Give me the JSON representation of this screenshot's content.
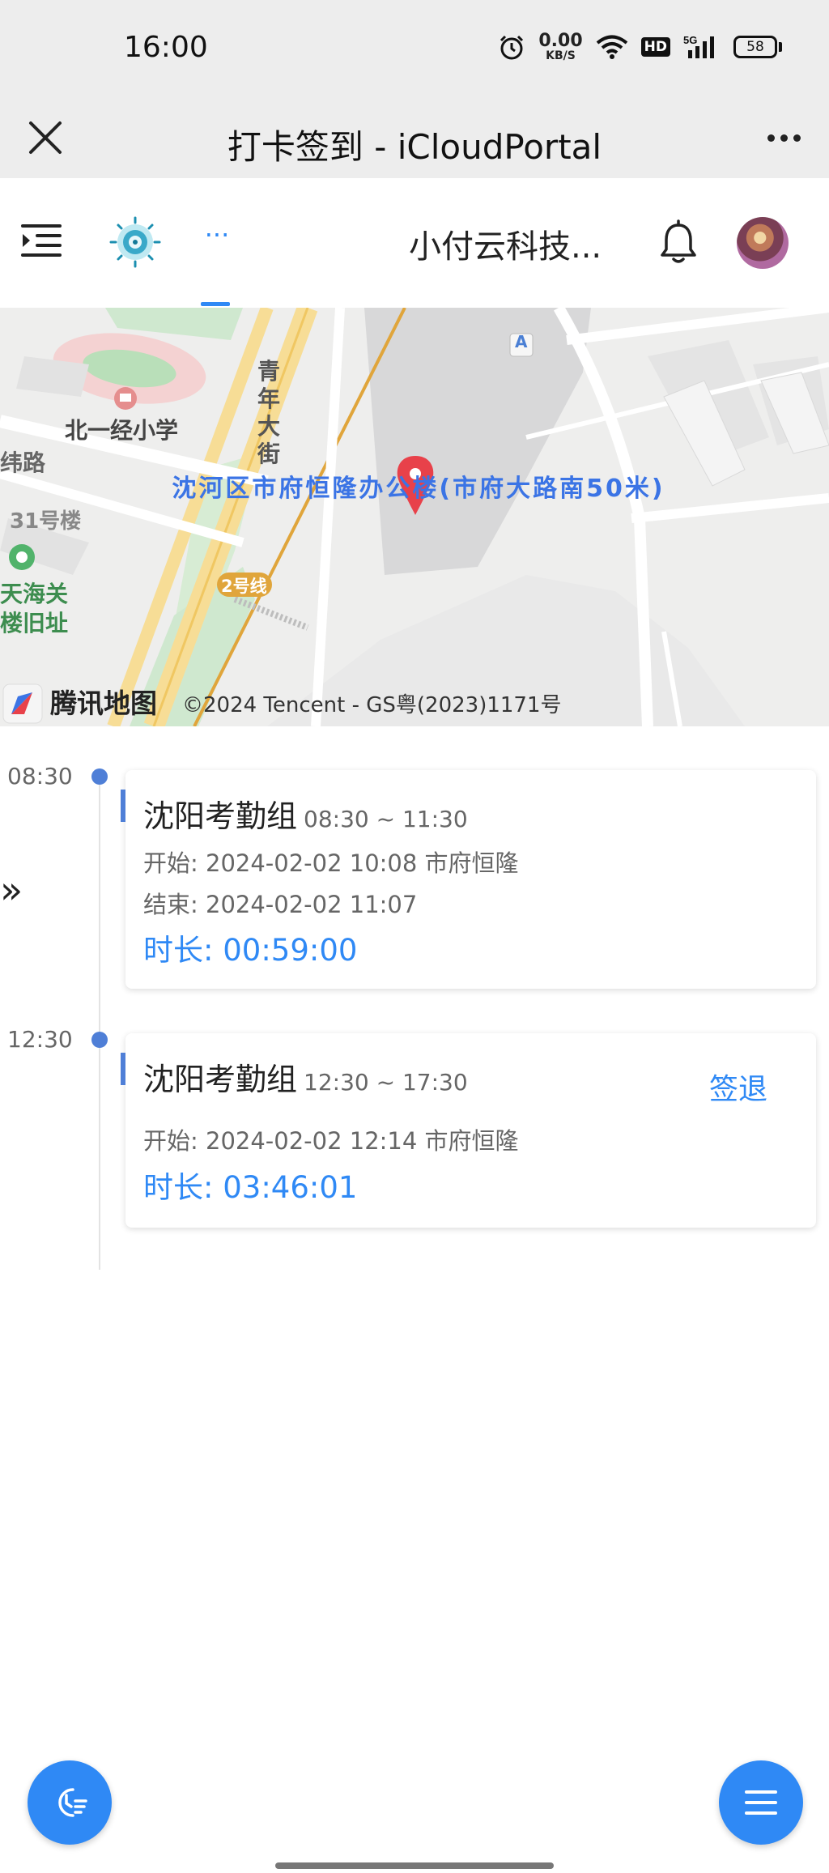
{
  "status_bar": {
    "time": "16:00",
    "net_speed_value": "0.00",
    "net_speed_unit": "KB/S",
    "hd_badge": "HD",
    "signal_label": "5G",
    "battery_level": "58",
    "icons": [
      "alarm-icon",
      "wifi-icon",
      "hd-icon",
      "signal-icon",
      "battery-icon"
    ]
  },
  "title_bar": {
    "title": "打卡签到 - iCloudPortal"
  },
  "app_header": {
    "company_name": "小付云科技...",
    "nav_more": "···"
  },
  "map": {
    "address": "沈河区市府恒隆办公楼(市府大路南50米)",
    "labels": {
      "school": "北一经小学",
      "street": "青年大街",
      "road": "纬路",
      "building": "31号楼",
      "site_line1": "天海关",
      "site_line2": "楼旧址",
      "metro": "2号线",
      "entrance": "A"
    },
    "provider": "腾讯地图",
    "copyright": "©2024 Tencent - GS粤(2023)1171号"
  },
  "timeline": {
    "expand_icon": "»",
    "slots": [
      {
        "time": "08:30",
        "group": "沈阳考勤组",
        "range": "08:30 ~ 11:30",
        "start_label": "开始:",
        "start_value": "2024-02-02 10:08 市府恒隆",
        "end_label": "结束:",
        "end_value": "2024-02-02 11:07",
        "duration_label": "时长:",
        "duration_value": "00:59:00"
      },
      {
        "time": "12:30",
        "group": "沈阳考勤组",
        "range": "12:30 ~ 17:30",
        "action": "签退",
        "start_label": "开始:",
        "start_value": "2024-02-02 12:14 市府恒隆",
        "duration_label": "时长:",
        "duration_value": "03:46:01"
      }
    ]
  },
  "colors": {
    "accent": "#2f89f5",
    "timeline_dot": "#4f7fd7",
    "address_text": "#3b74e5",
    "header_bg": "#ededed"
  }
}
